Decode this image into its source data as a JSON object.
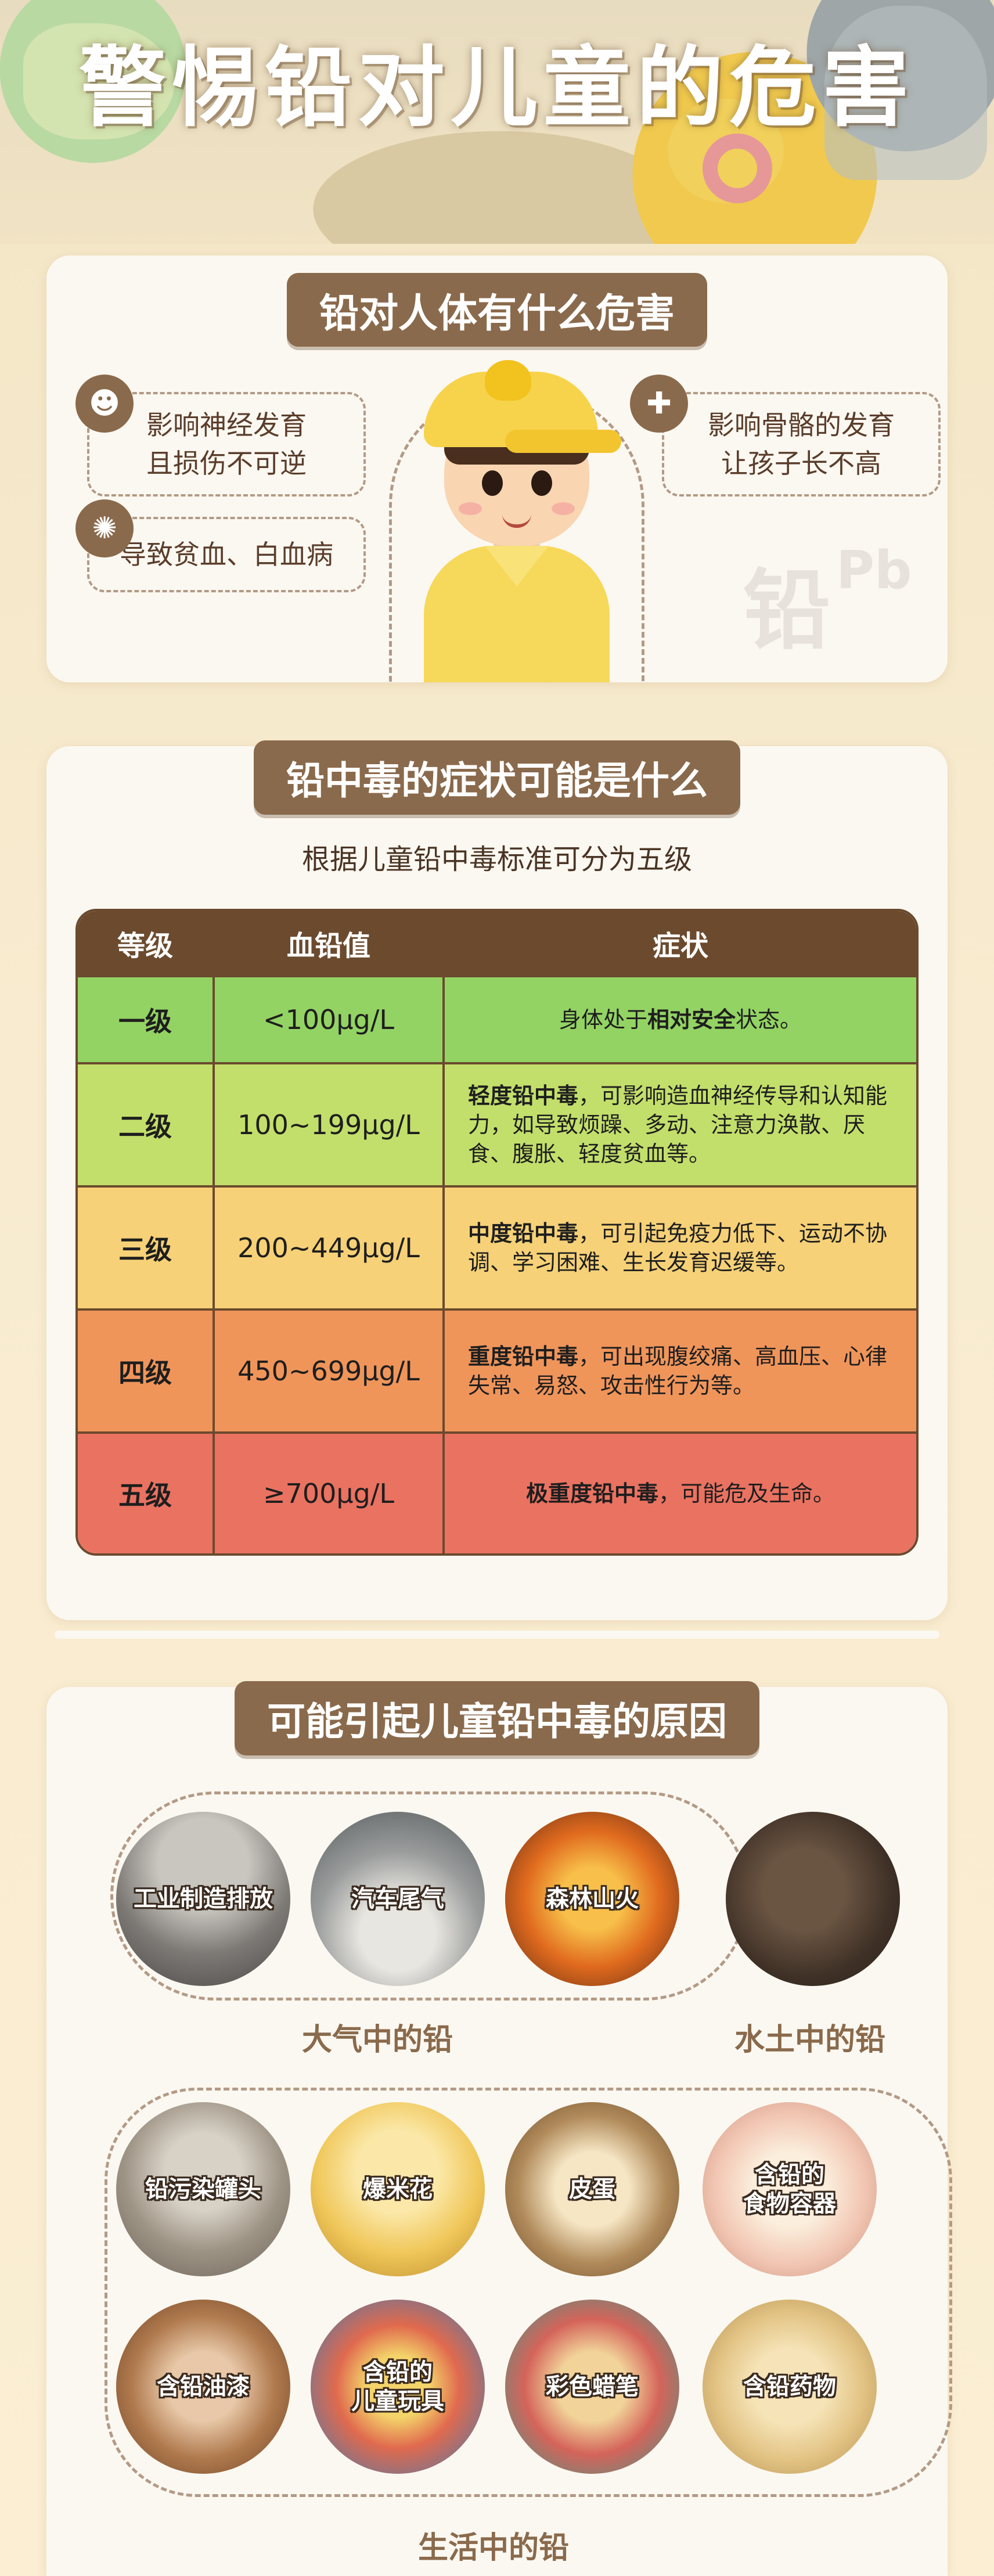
{
  "title": "警惕铅对儿童的危害",
  "section1": {
    "heading": "铅对人体有什么危害",
    "effects": [
      {
        "icon": "brain-icon",
        "line1": "影响神经发育",
        "line2": "且损伤不可逆"
      },
      {
        "icon": "blood-cell-icon",
        "line1": "导致贫血、白血病",
        "line2": ""
      },
      {
        "icon": "bone-icon",
        "line1": "影响骨骼的发育",
        "line2": "让孩子长不高"
      }
    ],
    "mark": "铅",
    "mark_symbol": "Pb"
  },
  "section2": {
    "heading": "铅中毒的症状可能是什么",
    "subtitle": "根据儿童铅中毒标准可分为五级",
    "headers": [
      "等级",
      "血铅值",
      "症状"
    ],
    "rows": [
      {
        "level": "一级",
        "value": "<100μg/L",
        "pre": "身体处于",
        "bold": "相对安全",
        "post": "状态。",
        "color": "#93d363"
      },
      {
        "level": "二级",
        "value": "100~199μg/L",
        "pre": "",
        "bold": "轻度铅中毒",
        "post": "，可影响造血神经传导和认知能力，如导致烦躁、多动、注意力涣散、厌食、腹胀、轻度贫血等。",
        "color": "#c3df6b"
      },
      {
        "level": "三级",
        "value": "200~449μg/L",
        "pre": "",
        "bold": "中度铅中毒",
        "post": "，可引起免疫力低下、运动不协调、学习困难、生长发育迟缓等。",
        "color": "#f6d177"
      },
      {
        "level": "四级",
        "value": "450~699μg/L",
        "pre": "",
        "bold": "重度铅中毒",
        "post": "，可出现腹绞痛、高血压、心律失常、易怒、攻击性行为等。",
        "color": "#f0955a"
      },
      {
        "level": "五级",
        "value": "≥700μg/L",
        "pre": "",
        "bold": "极重度铅中毒",
        "post": "，可能危及生命。",
        "color": "#ea7261"
      }
    ]
  },
  "section3": {
    "heading": "可能引起儿童铅中毒的原因",
    "air": {
      "label": "大气中的铅",
      "items": [
        "工业制造排放",
        "汽车尾气",
        "森林山火"
      ]
    },
    "soil": {
      "label": "水土中的铅",
      "items": [
        ""
      ]
    },
    "life": {
      "label": "生活中的铅",
      "items": [
        "铅污染罐头",
        "爆米花",
        "皮蛋",
        "含铅的\n食物容器",
        "含铅油漆",
        "含铅的\n儿童玩具",
        "彩色蜡笔",
        "含铅药物"
      ]
    }
  }
}
